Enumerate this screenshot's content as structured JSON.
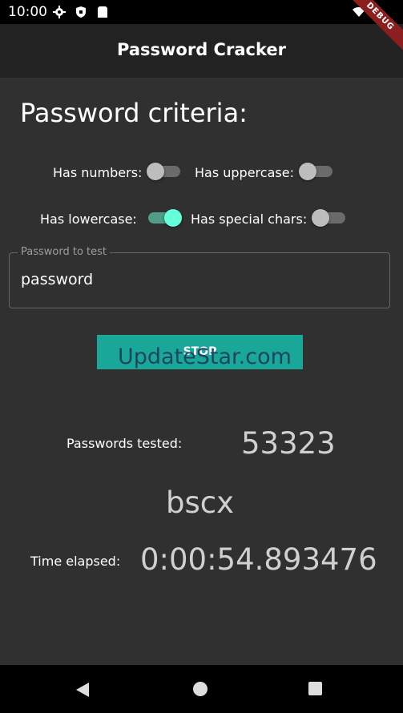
{
  "status_bar": {
    "time": "10:00"
  },
  "debug_banner": "DEBUG",
  "app_bar": {
    "title": "Password Cracker"
  },
  "criteria": {
    "title": "Password criteria:",
    "has_numbers": {
      "label": "Has numbers:",
      "on": false
    },
    "has_uppercase": {
      "label": "Has uppercase:",
      "on": false
    },
    "has_lowercase": {
      "label": "Has lowercase:",
      "on": true
    },
    "has_special": {
      "label": "Has special chars:",
      "on": false
    }
  },
  "password_field": {
    "label": "Password to test",
    "value": "password"
  },
  "stop_button": {
    "label": "STOP"
  },
  "watermark": "UpdateStar.com",
  "stats": {
    "passwords_tested_label": "Passwords tested:",
    "passwords_tested_value": "53323",
    "current_guess": "bscx",
    "time_elapsed_label": "Time elapsed:",
    "time_elapsed_value": "0:00:54.893476"
  },
  "colors": {
    "background": "#303030",
    "app_bar": "#222222",
    "accent": "#64ffda",
    "button": "#19a898"
  }
}
